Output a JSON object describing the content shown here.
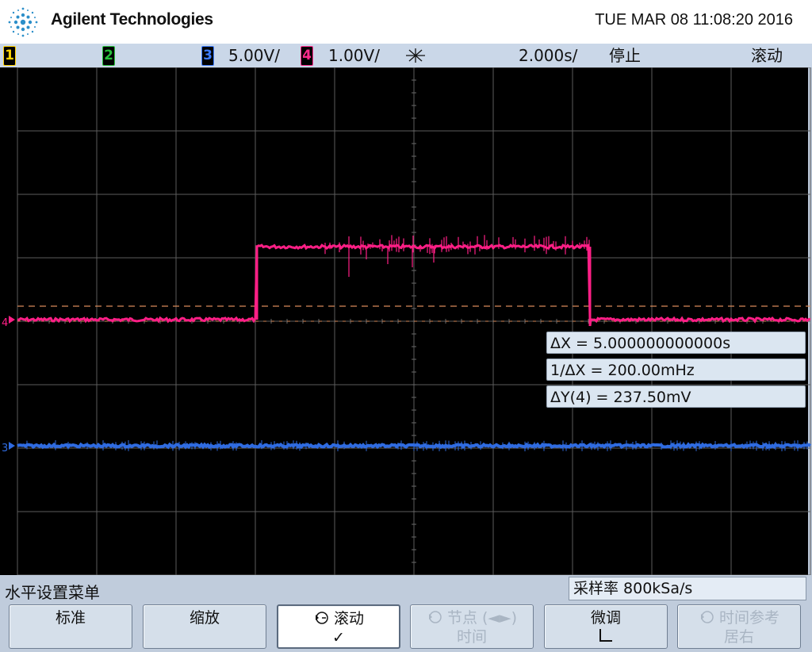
{
  "header": {
    "brand": "Agilent Technologies",
    "datetime": "TUE MAR 08 11:08:20 2016"
  },
  "status": {
    "ch1": "1",
    "ch2": "2",
    "ch3": "3",
    "ch3_scale": "5.00V/",
    "ch4": "4",
    "ch4_scale": "1.00V/",
    "timebase": "2.000s/",
    "run_state": "停止",
    "mode": "滚动"
  },
  "colors": {
    "ch1": "#ffd200",
    "ch2": "#27c03a",
    "ch3": "#2f6be0",
    "ch4": "#ff1f86",
    "cursor": "#d98a5a"
  },
  "trace_markers": {
    "ch4": "4",
    "ch3": "3"
  },
  "measurements": {
    "delta_x": "ΔX = 5.000000000000s",
    "inv_delta_x": "1/ΔX = 200.00mHz",
    "delta_y": "ΔY(4) = 237.50mV"
  },
  "menu": {
    "title": "水平设置菜单",
    "sample_rate": "采样率 800kSa/s",
    "softkeys": {
      "normal": "标准",
      "zoom": "缩放",
      "roll": "滚动",
      "roll_check": "✓",
      "node_line1": "节点 (◄►)",
      "node_line2": "时间",
      "fine": "微调",
      "timeref_line1": "时间参考",
      "timeref_line2": "居右"
    }
  },
  "icons": {
    "logo": "agilent-spark-icon",
    "trigger": "trigger-spark-icon",
    "roll": "roll-mode-icon"
  }
}
